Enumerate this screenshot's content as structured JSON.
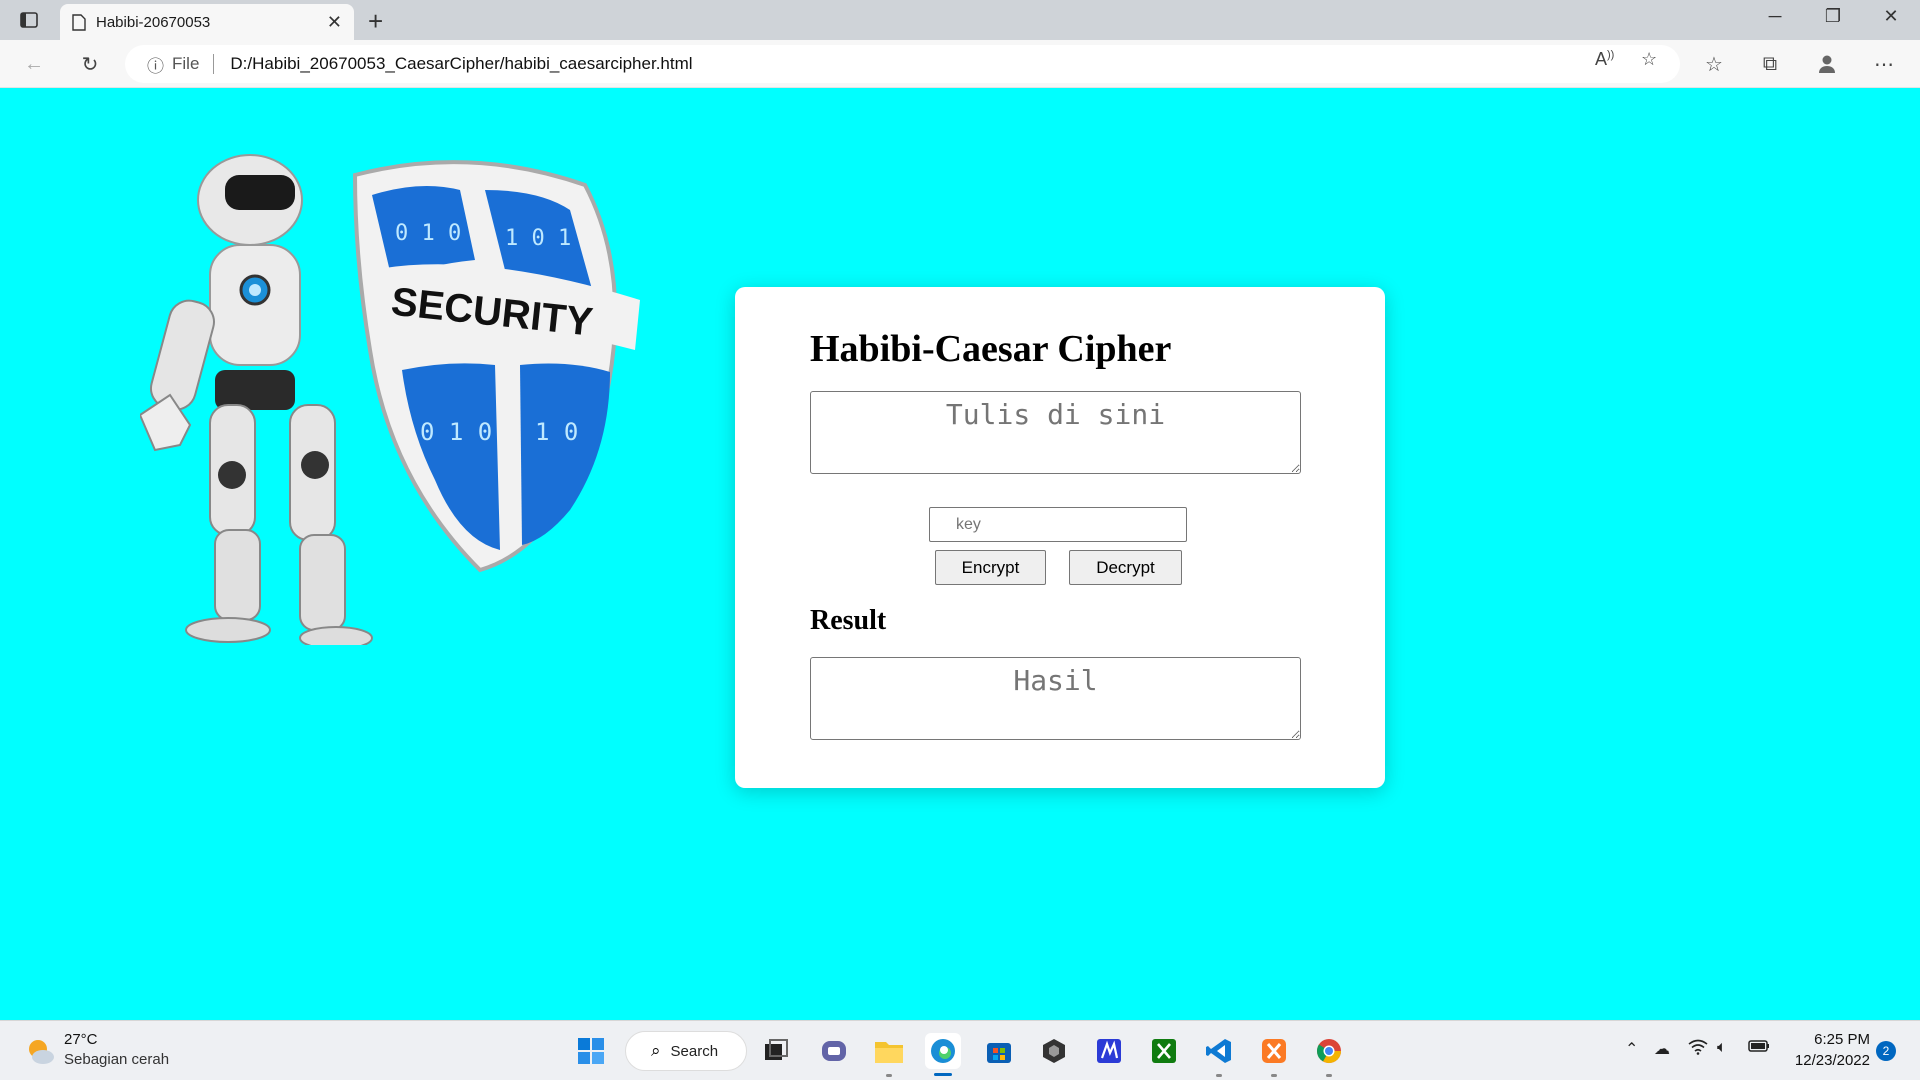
{
  "browser": {
    "tab_title": "Habibi-20670053",
    "address_scheme": "File",
    "url": "D:/Habibi_20670053_CaesarCipher/habibi_caesarcipher.html"
  },
  "page": {
    "title": "Habibi-Caesar Cipher",
    "input_placeholder": "Tulis di sini",
    "key_placeholder": "key",
    "encrypt_label": "Encrypt",
    "decrypt_label": "Decrypt",
    "result_heading": "Result",
    "result_placeholder": "Hasil",
    "image_text": "SECURITY",
    "background_color": "#00ffff"
  },
  "taskbar": {
    "weather_temp": "27°C",
    "weather_desc": "Sebagian cerah",
    "search_label": "Search",
    "time": "6:25 PM",
    "date": "12/23/2022",
    "notification_count": "2"
  }
}
